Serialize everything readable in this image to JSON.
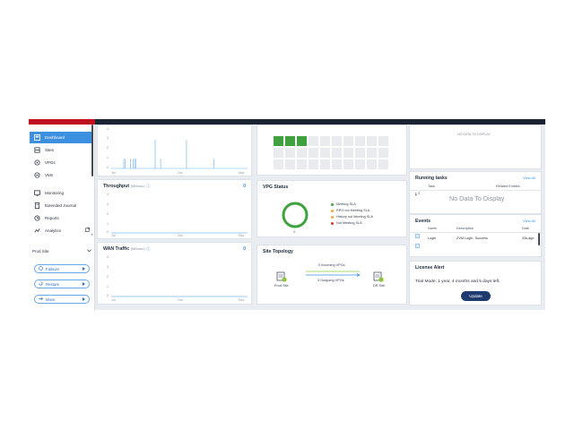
{
  "sidebar": {
    "items": [
      {
        "label": "Dashboard",
        "icon": "dashboard-icon",
        "active": true
      },
      {
        "label": "Sites",
        "icon": "sites-icon"
      },
      {
        "label": "VPGs",
        "icon": "vpgs-icon"
      },
      {
        "label": "VMs",
        "icon": "vms-icon"
      },
      {
        "label": "Monitoring",
        "icon": "monitoring-icon"
      },
      {
        "label": "Extended Journal",
        "icon": "journal-icon"
      },
      {
        "label": "Reports",
        "icon": "reports-icon"
      },
      {
        "label": "Analytics",
        "icon": "analytics-icon"
      }
    ],
    "site_select": "Prod Site",
    "actions": [
      {
        "label": "Failover"
      },
      {
        "label": "Restore"
      },
      {
        "label": "Move"
      }
    ]
  },
  "iops_chart": {
    "y_ticks": [
      "4",
      "3",
      "2",
      "1",
      "0"
    ],
    "x_ticks": [
      "Jul",
      "Oct",
      "Nov"
    ],
    "chart_data": {
      "type": "bar",
      "values": [
        0.0,
        0.0,
        0.0,
        0.0,
        0.0,
        0.0,
        0.0,
        0.0,
        0.0,
        1.0,
        1.0,
        0.0,
        0.0,
        0.0,
        1.0,
        0.0,
        1.0,
        1.0,
        1.0,
        0.0,
        0.0,
        0.0,
        0.0,
        0.0,
        0.0,
        0.0,
        0.0,
        0.0,
        0.0,
        0.0,
        0.0,
        0.0,
        3.0,
        0.0,
        0.0,
        0.0,
        1.0,
        0.0,
        0.0,
        0.0,
        0.0,
        0.0,
        0.0,
        0.0,
        0.0,
        0.0,
        0.0,
        0.0,
        0.0,
        0.0,
        0.0,
        0.0,
        0.0,
        0.0,
        0.0,
        3.0,
        0.0,
        0.0,
        0.0,
        0.0,
        0.0,
        0.0,
        0.0,
        0.0,
        0.0,
        0.0,
        0.0,
        0.0,
        0.0,
        0.0,
        0.0,
        0.0,
        0.0,
        0.0,
        0.0,
        1.0,
        0.0,
        0.0,
        0.0,
        0.0,
        0.0,
        0.0,
        0.0,
        0.0,
        0.0,
        0.0,
        0.0,
        0.0,
        0.0,
        0.0,
        0.0,
        0.0,
        0.0,
        0.0,
        0.0,
        0.0,
        0.0,
        0.0,
        0.0,
        0.0
      ],
      "ylim": [
        0,
        4
      ]
    }
  },
  "throughput": {
    "title": "Throughput",
    "unit": "(MB/sec)",
    "count": "0",
    "y_ticks": [
      "4",
      "3",
      "2",
      "1",
      "0"
    ],
    "x_ticks": [
      "Jul",
      "Oct",
      "Nov"
    ]
  },
  "wan": {
    "title": "WAN Traffic",
    "unit": "(MB/sec)",
    "count": "0",
    "y_ticks": [
      "4",
      "3",
      "2",
      "1",
      "0"
    ],
    "x_ticks": [
      "Jul",
      "Oct",
      "Nov"
    ]
  },
  "vpg_grid": {
    "total": 30,
    "active": 3,
    "active_color": "#3fa23f"
  },
  "vpg_status": {
    "title": "VPG Status",
    "center_value": "3",
    "legend": [
      {
        "label": "Meeting SLA",
        "color": "#3fa23f"
      },
      {
        "label": "RPO not Meeting SLA",
        "color": "#f0a830"
      },
      {
        "label": "History not Meeting SLA",
        "color": "#f0a830"
      },
      {
        "label": "Not Meeting SLA",
        "color": "#d9342b"
      }
    ]
  },
  "topology": {
    "title": "Site Topology",
    "incoming": "0 Incoming VPGs",
    "outgoing": "3 Outgoing VPGs",
    "left_site": "Prod Site",
    "right_site": "DR Site"
  },
  "alerts_panel": {
    "empty": "NO DATA TO DISPLAY"
  },
  "running_tasks": {
    "title": "Running tasks",
    "view_all": "View All",
    "col_task": "Task",
    "col_entities": "Related Entities",
    "empty": "No Data To Display"
  },
  "events": {
    "title": "Events",
    "view_all": "View All",
    "cols": [
      "Name",
      "Description",
      "Date"
    ],
    "rows": [
      {
        "name": "Login",
        "description": "ZVM Login. Success",
        "date": "33s ago"
      }
    ]
  },
  "license": {
    "title": "License Alert",
    "text": "Trial Mode: 1 year, 4 months and 5 days left.",
    "button": "Update"
  },
  "colors": {
    "accent": "#3d8fe0",
    "brand": "#c1121f",
    "topbar": "#1b2433"
  }
}
